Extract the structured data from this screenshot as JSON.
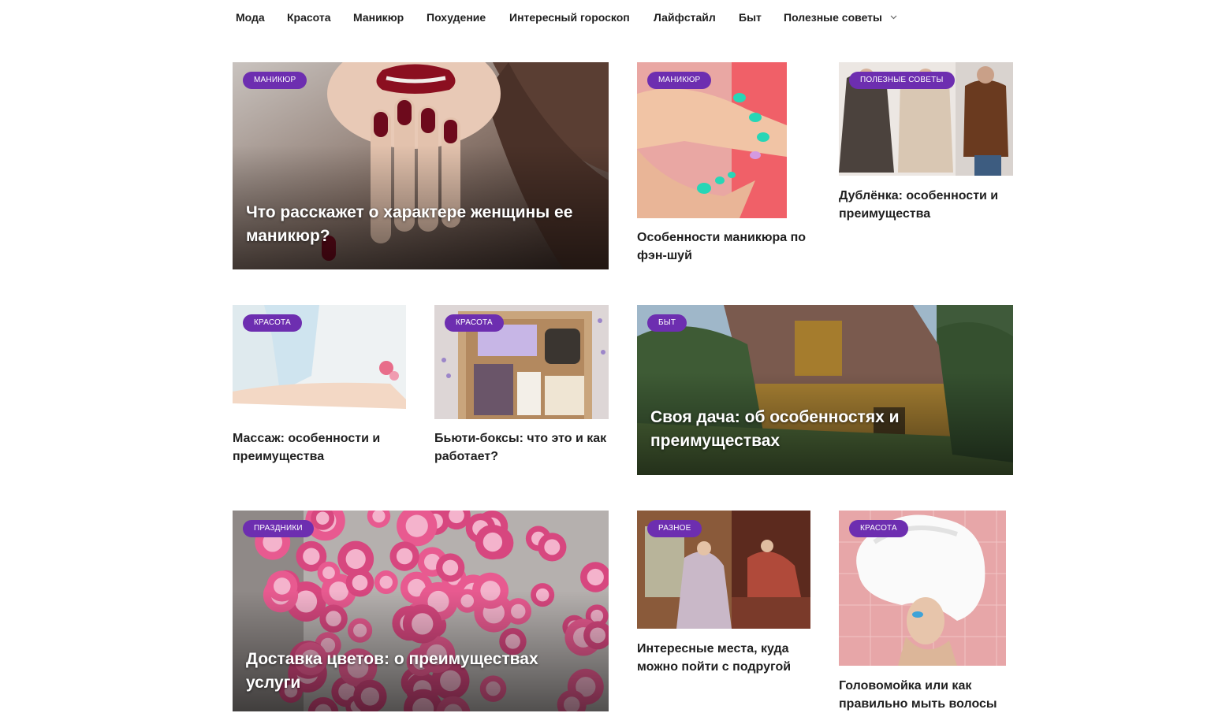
{
  "nav": {
    "items": [
      "Мода",
      "Красота",
      "Маникюр",
      "Похудение",
      "Интересный гороскоп",
      "Лайфстайл",
      "Быт",
      "Полезные советы"
    ],
    "dropdown_icon": "chevron-down-icon"
  },
  "colors": {
    "badge": "#6d2eb0",
    "title_text": "#1f1f1f",
    "overlay_text": "#ffffff"
  },
  "posts": [
    {
      "category": "Маникюр",
      "title": "Что расскажет о характере женщины ее маникюр?"
    },
    {
      "category": "Маникюр",
      "title": "Особенности маникюра по фэн-шуй"
    },
    {
      "category": "Полезные советы",
      "title": "Дублёнка: особенности и преимущества"
    },
    {
      "category": "Красота",
      "title": "Массаж: особенности и преимущества"
    },
    {
      "category": "Красота",
      "title": "Бьюти-боксы: что это и как работает?"
    },
    {
      "category": "Быт",
      "title": "Своя дача: об особенностях и преимуществах"
    },
    {
      "category": "Праздники",
      "title": "Доставка цветов: о преимуществах услуги"
    },
    {
      "category": "Разное",
      "title": "Интересные места, куда можно пойти с подругой"
    },
    {
      "category": "Красота",
      "title": "Головомойка или как правильно мыть волосы"
    }
  ]
}
